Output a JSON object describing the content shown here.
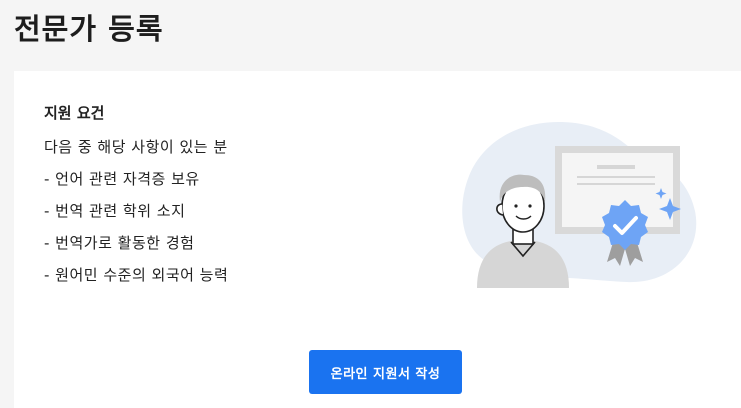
{
  "page": {
    "title": "전문가 등록"
  },
  "requirements": {
    "title": "지원 요건",
    "items": [
      "다음 중 해당 사항이 있는 분",
      "- 언어 관련 자격증 보유",
      "- 번역 관련 학위 소지",
      "- 번역가로 활동한 경험",
      "- 원어민 수준의 외국어 능력"
    ]
  },
  "illustration": {
    "icon": "certified-expert-icon",
    "colors": {
      "blob": "#e8eef6",
      "person": "#d6d6d6",
      "certificate": "#f5f5f5",
      "badge": "#6ea4f5",
      "sparkle": "#6ea4f5"
    }
  },
  "actions": {
    "apply_label": "온라인 지원서 작성"
  },
  "colors": {
    "accent": "#1a73f0",
    "background": "#f5f5f5",
    "card": "#ffffff"
  }
}
